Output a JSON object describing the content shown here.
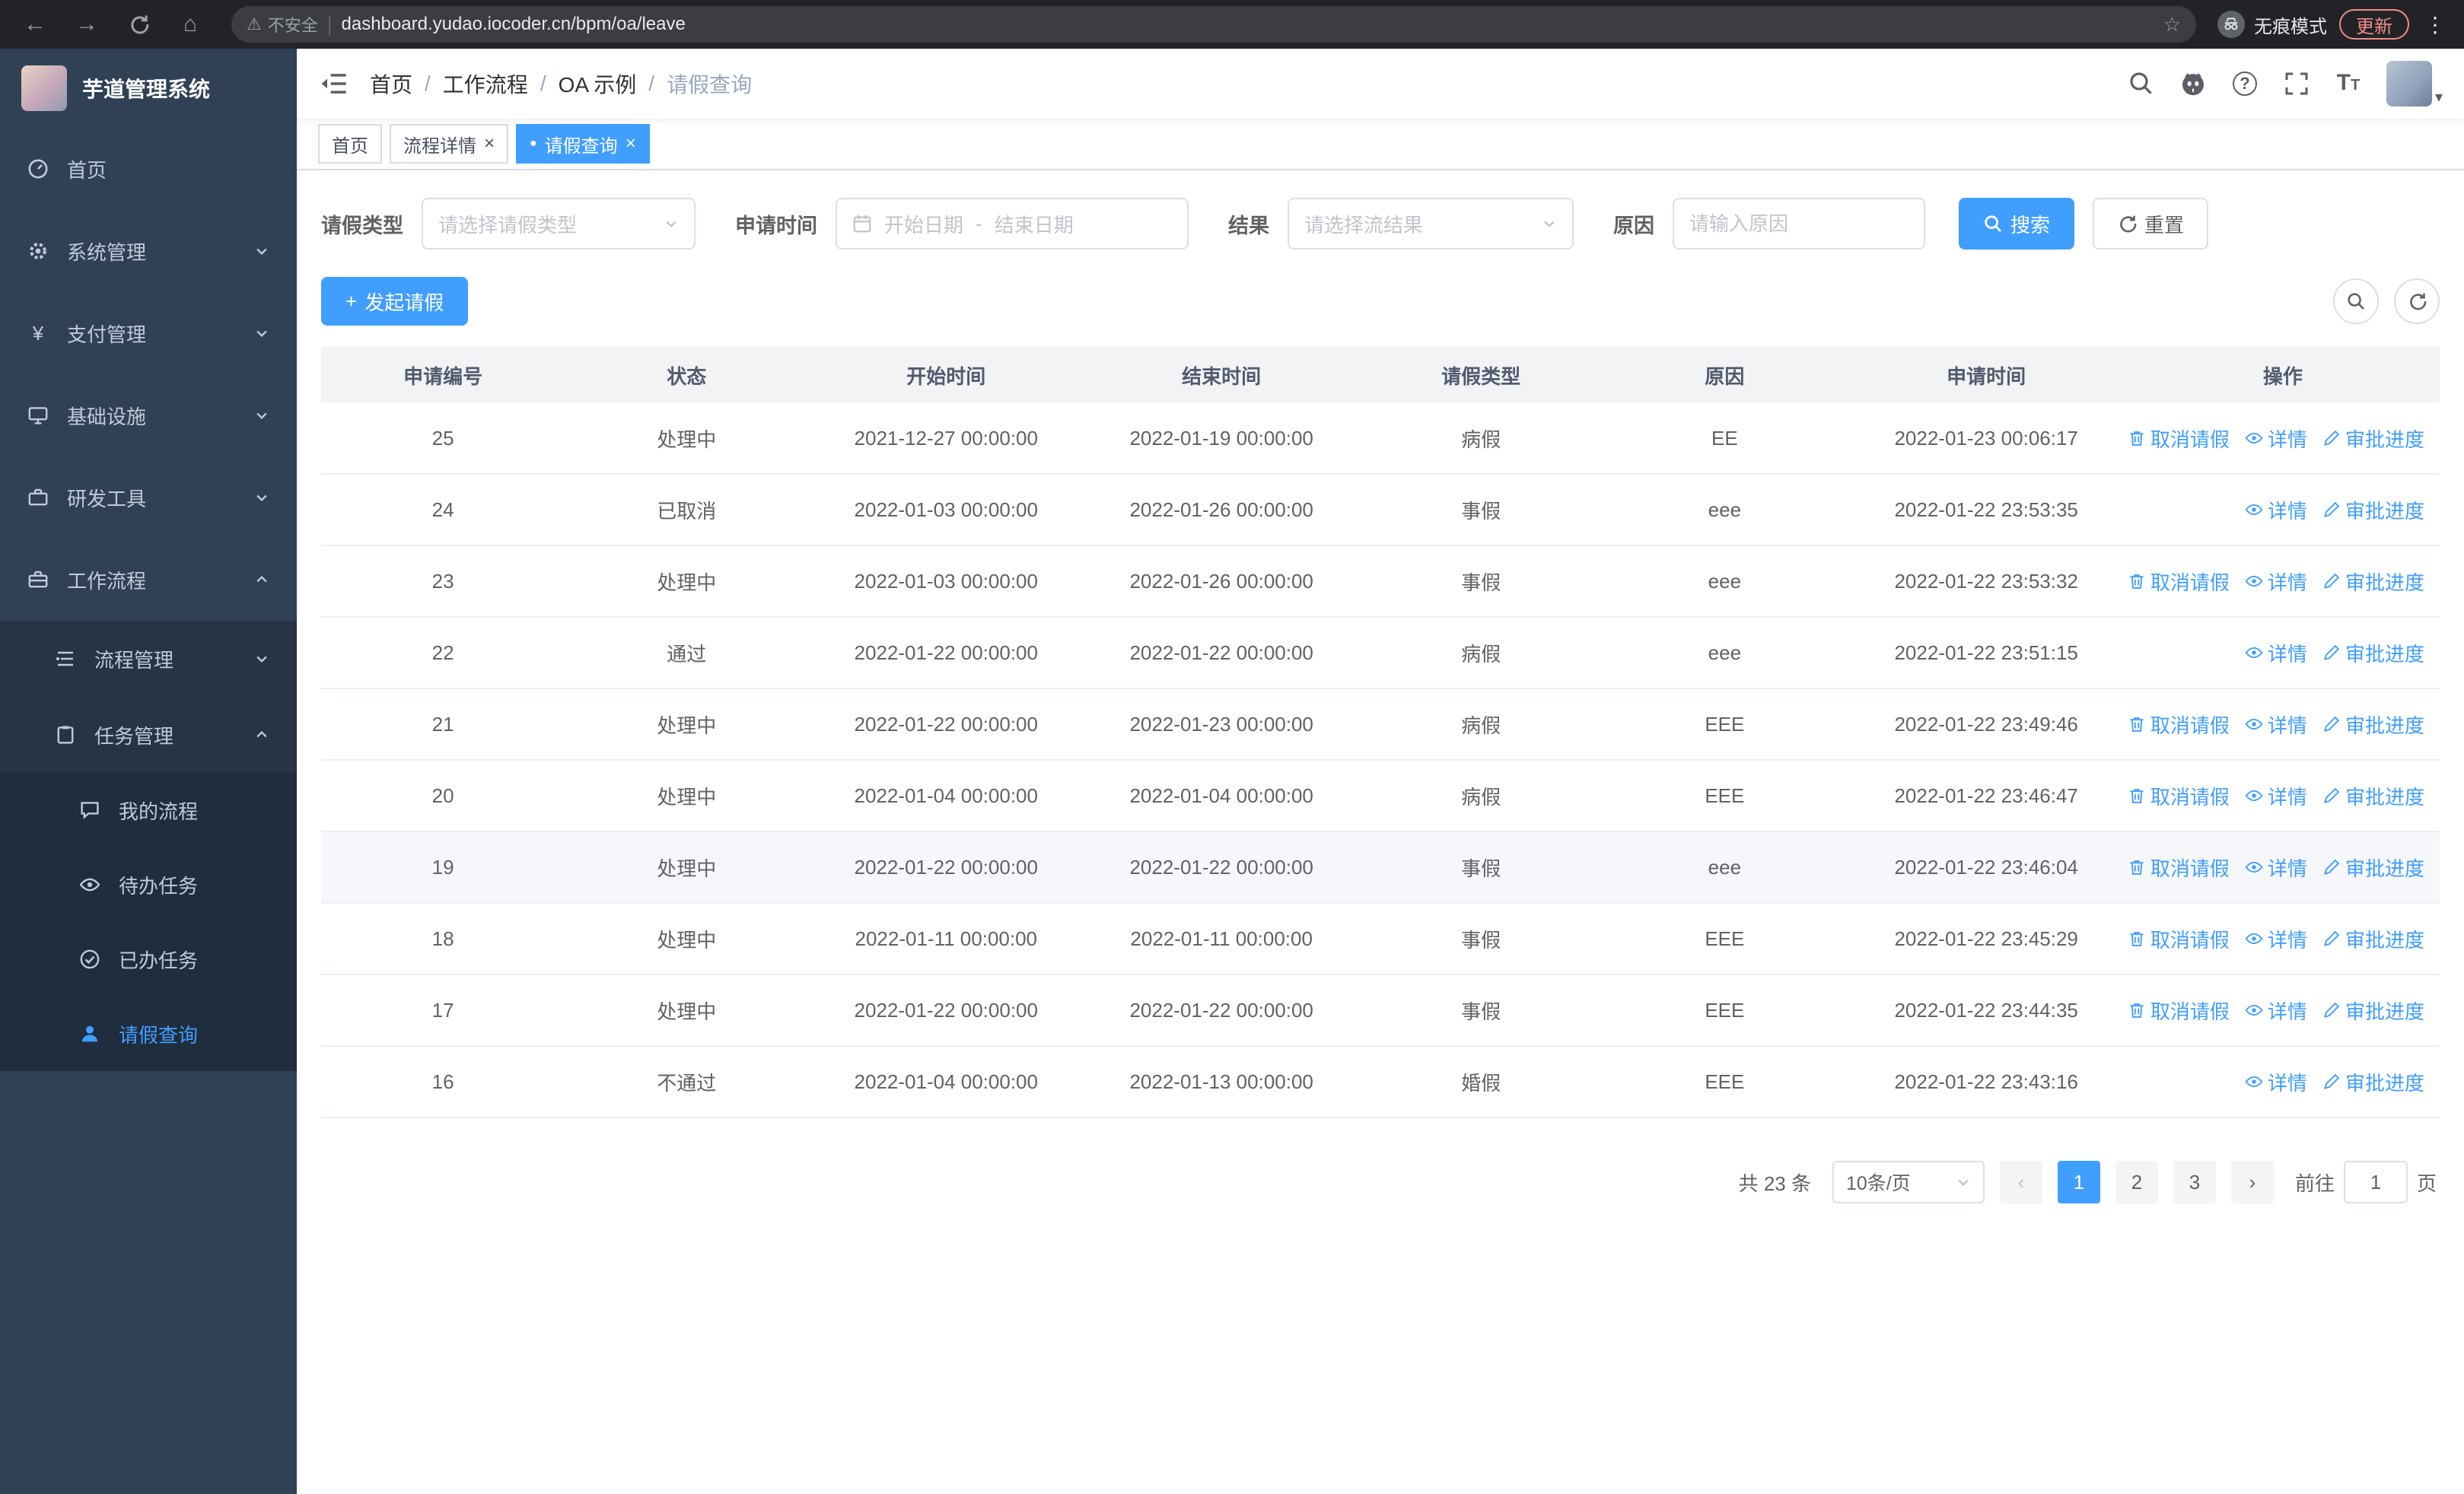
{
  "browser": {
    "security_warning": "不安全",
    "url": "dashboard.yudao.iocoder.cn/bpm/oa/leave",
    "incognito_label": "无痕模式",
    "update_label": "更新"
  },
  "icons": {
    "back": "←",
    "forward": "→",
    "home": "⌂",
    "warning": "⚠",
    "star": "☆",
    "kebab": "⋮",
    "question": "?",
    "caret": "▾",
    "tab_dot": "●",
    "close": "×",
    "plus": "+",
    "font_size_large": "T",
    "font_size_small": "T",
    "prev_arrow": "‹",
    "next_arrow": "›"
  },
  "sidebar": {
    "logo_title": "芋道管理系统",
    "items": [
      {
        "label": "首页"
      },
      {
        "label": "系统管理"
      },
      {
        "label": "支付管理"
      },
      {
        "label": "基础设施"
      },
      {
        "label": "研发工具"
      },
      {
        "label": "工作流程"
      }
    ],
    "submenu": [
      {
        "label": "流程管理"
      },
      {
        "label": "任务管理"
      }
    ],
    "task_items": [
      {
        "label": "我的流程"
      },
      {
        "label": "待办任务"
      },
      {
        "label": "已办任务"
      },
      {
        "label": "请假查询"
      }
    ]
  },
  "header": {
    "separator": "/",
    "breadcrumb": [
      "首页",
      "工作流程",
      "OA 示例",
      "请假查询"
    ]
  },
  "tabs": [
    {
      "label": "首页"
    },
    {
      "label": "流程详情"
    },
    {
      "label": "请假查询"
    }
  ],
  "filters": {
    "leave_type_label": "请假类型",
    "leave_type_placeholder": "请选择请假类型",
    "apply_time_label": "申请时间",
    "start_date_placeholder": "开始日期",
    "date_separator": "-",
    "end_date_placeholder": "结束日期",
    "result_label": "结果",
    "result_placeholder": "请选择流结果",
    "reason_label": "原因",
    "reason_placeholder": "请输入原因",
    "search_button": "搜索",
    "reset_button": "重置"
  },
  "toolbar": {
    "create_button": "发起请假"
  },
  "table": {
    "columns": [
      "申请编号",
      "状态",
      "开始时间",
      "结束时间",
      "请假类型",
      "原因",
      "申请时间",
      "操作"
    ],
    "actions": {
      "cancel": "取消请假",
      "detail": "详情",
      "progress": "审批进度"
    },
    "rows": [
      {
        "id": "25",
        "status": "处理中",
        "start": "2021-12-27 00:00:00",
        "end": "2022-01-19 00:00:00",
        "type": "病假",
        "reason": "EE",
        "applied": "2022-01-23 00:06:17",
        "can_cancel": true,
        "highlighted": false
      },
      {
        "id": "24",
        "status": "已取消",
        "start": "2022-01-03 00:00:00",
        "end": "2022-01-26 00:00:00",
        "type": "事假",
        "reason": "eee",
        "applied": "2022-01-22 23:53:35",
        "can_cancel": false,
        "highlighted": false
      },
      {
        "id": "23",
        "status": "处理中",
        "start": "2022-01-03 00:00:00",
        "end": "2022-01-26 00:00:00",
        "type": "事假",
        "reason": "eee",
        "applied": "2022-01-22 23:53:32",
        "can_cancel": true,
        "highlighted": false
      },
      {
        "id": "22",
        "status": "通过",
        "start": "2022-01-22 00:00:00",
        "end": "2022-01-22 00:00:00",
        "type": "病假",
        "reason": "eee",
        "applied": "2022-01-22 23:51:15",
        "can_cancel": false,
        "highlighted": false
      },
      {
        "id": "21",
        "status": "处理中",
        "start": "2022-01-22 00:00:00",
        "end": "2022-01-23 00:00:00",
        "type": "病假",
        "reason": "EEE",
        "applied": "2022-01-22 23:49:46",
        "can_cancel": true,
        "highlighted": false
      },
      {
        "id": "20",
        "status": "处理中",
        "start": "2022-01-04 00:00:00",
        "end": "2022-01-04 00:00:00",
        "type": "病假",
        "reason": "EEE",
        "applied": "2022-01-22 23:46:47",
        "can_cancel": true,
        "highlighted": false
      },
      {
        "id": "19",
        "status": "处理中",
        "start": "2022-01-22 00:00:00",
        "end": "2022-01-22 00:00:00",
        "type": "事假",
        "reason": "eee",
        "applied": "2022-01-22 23:46:04",
        "can_cancel": true,
        "highlighted": true
      },
      {
        "id": "18",
        "status": "处理中",
        "start": "2022-01-11 00:00:00",
        "end": "2022-01-11 00:00:00",
        "type": "事假",
        "reason": "EEE",
        "applied": "2022-01-22 23:45:29",
        "can_cancel": true,
        "highlighted": false
      },
      {
        "id": "17",
        "status": "处理中",
        "start": "2022-01-22 00:00:00",
        "end": "2022-01-22 00:00:00",
        "type": "事假",
        "reason": "EEE",
        "applied": "2022-01-22 23:44:35",
        "can_cancel": true,
        "highlighted": false
      },
      {
        "id": "16",
        "status": "不通过",
        "start": "2022-01-04 00:00:00",
        "end": "2022-01-13 00:00:00",
        "type": "婚假",
        "reason": "EEE",
        "applied": "2022-01-22 23:43:16",
        "can_cancel": false,
        "highlighted": false
      }
    ]
  },
  "pagination": {
    "total_text": "共 23 条",
    "page_size": "10条/页",
    "pages": [
      "1",
      "2",
      "3"
    ],
    "current_page": "1",
    "goto_label": "前往",
    "goto_value": "1",
    "page_label": "页"
  },
  "colors": {
    "accent": "#409eff",
    "sidebar_bg": "#304156",
    "submenu_bg": "#1f2d3d",
    "table_header_bg": "#f2f3f5"
  }
}
